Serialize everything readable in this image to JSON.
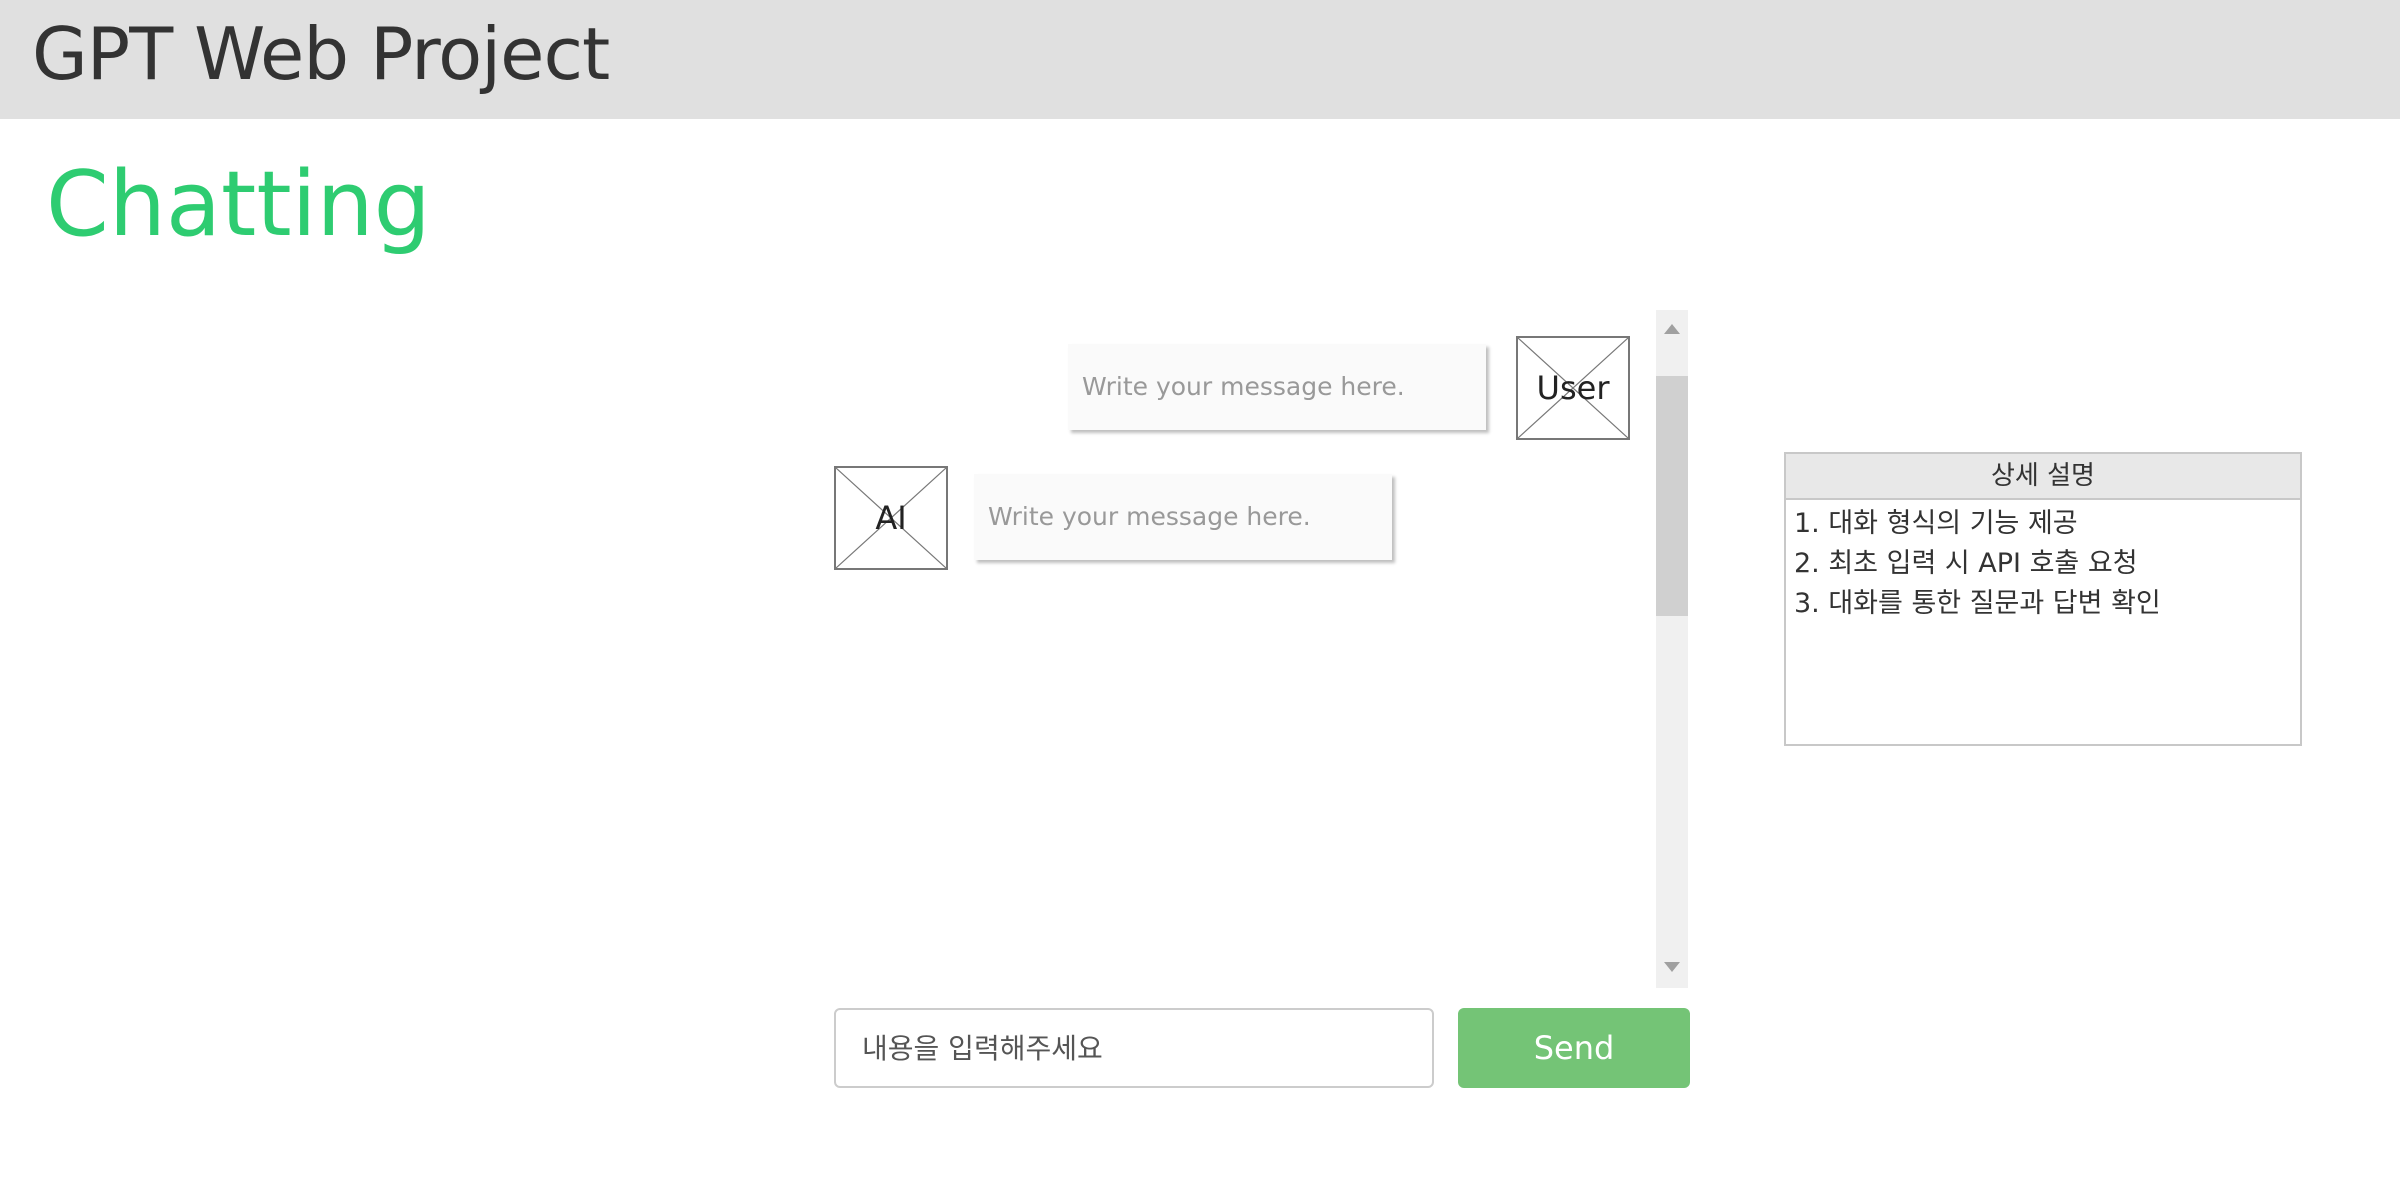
{
  "header": {
    "app_title": "GPT Web Project"
  },
  "page": {
    "title": "Chatting"
  },
  "chat": {
    "messages": [
      {
        "role_label": "User",
        "text": "Write your message here."
      },
      {
        "role_label": "AI",
        "text": "Write your message here."
      }
    ]
  },
  "composer": {
    "placeholder": "내용을 입력해주세요",
    "value": "",
    "send_label": "Send"
  },
  "description": {
    "title": "상세 설명",
    "items": [
      "1. 대화 형식의 기능 제공",
      "2. 최초 입력 시 API 호출 요청",
      "3. 대화를 통한 질문과 답변 확인"
    ]
  },
  "colors": {
    "header_bg": "#e0e0e0",
    "title_accent": "#2ecc71",
    "send_button": "#74c476"
  }
}
